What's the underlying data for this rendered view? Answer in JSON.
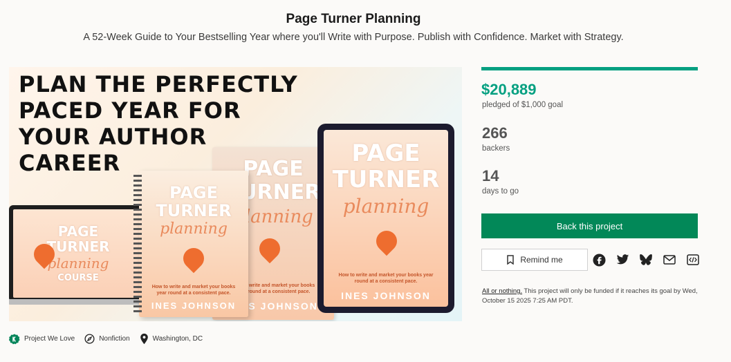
{
  "project": {
    "title": "Page Turner Planning",
    "subtitle": "A 52-Week Guide to Your Bestselling Year where you'll Write with Purpose. Publish with Confidence. Market with Strategy."
  },
  "hero": {
    "headline": "PLAN THE PERFECTLY\nPACED YEAR FOR\nYOUR AUTHOR\nCAREER",
    "laptop": {
      "line1": "PAGE",
      "line2": "TURNER",
      "script": "planning",
      "line3": "COURSE"
    },
    "book_front": {
      "line1": "PAGE",
      "line2": "TURNER",
      "script": "planning",
      "tagline": "How to write and market your books year round at a consistent pace.",
      "author": "INES JOHNSON"
    },
    "book_back": {
      "line1": "PAGE",
      "line2": "TURNER",
      "script": "planning",
      "tagline": "How to write and market your books year round at a consistent pace.",
      "author": "INES JOHNSON"
    },
    "tablet": {
      "line1": "PAGE",
      "line2": "TURNER",
      "script": "planning",
      "tagline": "How to write and market your books year round at a consistent pace.",
      "author": "INES JOHNSON"
    }
  },
  "stats": {
    "progress_fraction": 1.0,
    "pledged": "$20,889",
    "pledged_label": "pledged of $1,000 goal",
    "backers": "266",
    "backers_label": "backers",
    "days": "14",
    "days_label": "days to go"
  },
  "actions": {
    "back_label": "Back this project",
    "remind_label": "Remind me",
    "social_icons": [
      "facebook-icon",
      "twitter-icon",
      "bluesky-icon",
      "email-icon",
      "embed-icon"
    ]
  },
  "fine_print": {
    "link": "All or nothing.",
    "text": " This project will only be funded if it reaches its goal by Wed, October 15 2025 7:25 AM PDT."
  },
  "tags": [
    {
      "icon": "kickstarter-badge-icon",
      "label": "Project We Love"
    },
    {
      "icon": "compass-icon",
      "label": "Nonfiction"
    },
    {
      "icon": "location-pin-icon",
      "label": "Washington, DC"
    }
  ],
  "colors": {
    "accent": "#05a081",
    "button": "#028858"
  }
}
